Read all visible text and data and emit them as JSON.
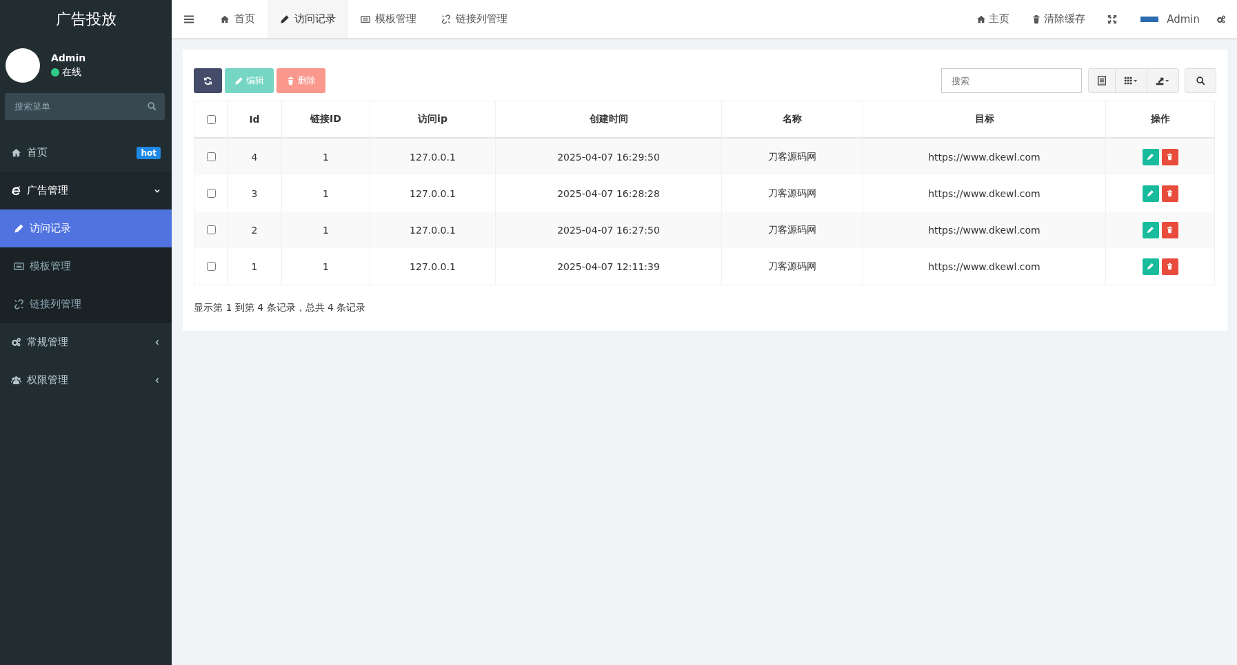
{
  "sidebar": {
    "title": "广告投放",
    "user": {
      "name": "Admin",
      "status": "在线",
      "online": true
    },
    "search": {
      "placeholder": "搜索菜单"
    },
    "items": [
      {
        "kind": "link",
        "label": "首页",
        "badge": "hot",
        "selected": false
      },
      {
        "kind": "group",
        "label": "广告管理",
        "expanded": true,
        "selected": false,
        "children": [
          {
            "label": "访问记录",
            "selected": true
          },
          {
            "label": "模板管理",
            "selected": false
          },
          {
            "label": "链接列管理",
            "selected": false
          }
        ]
      },
      {
        "kind": "group",
        "label": "常规管理",
        "expanded": false,
        "selected": false
      },
      {
        "kind": "group",
        "label": "权限管理",
        "expanded": false,
        "selected": false
      }
    ]
  },
  "tabs": [
    {
      "label": "首页",
      "selected": false
    },
    {
      "label": "访问记录",
      "selected": true
    },
    {
      "label": "模板管理",
      "selected": false
    },
    {
      "label": "链接列管理",
      "selected": false
    }
  ],
  "navbar": {
    "links": [
      "主页",
      "清除缓存"
    ],
    "user": "Admin"
  },
  "toolbar": {
    "buttons": [
      {
        "kind": "refresh",
        "disabled": false
      },
      {
        "kind": "edit",
        "label": "编辑",
        "disabled": true
      },
      {
        "kind": "delete",
        "label": "删除",
        "disabled": true
      }
    ],
    "search": {
      "placeholder": "搜索"
    }
  },
  "table": {
    "all_checked": false,
    "columns": [
      "Id",
      "链接ID",
      "访问ip",
      "创建时间",
      "名称",
      "目标",
      "操作"
    ],
    "rows": [
      {
        "checked": false,
        "cells": [
          "4",
          "1",
          "127.0.0.1",
          "2025-04-07 16:29:50",
          "刀客源码网",
          "https://www.dkewl.com"
        ]
      },
      {
        "checked": false,
        "cells": [
          "3",
          "1",
          "127.0.0.1",
          "2025-04-07 16:28:28",
          "刀客源码网",
          "https://www.dkewl.com"
        ]
      },
      {
        "checked": false,
        "cells": [
          "2",
          "1",
          "127.0.0.1",
          "2025-04-07 16:27:50",
          "刀客源码网",
          "https://www.dkewl.com"
        ]
      },
      {
        "checked": false,
        "cells": [
          "1",
          "1",
          "127.0.0.1",
          "2025-04-07 12:11:39",
          "刀客源码网",
          "https://www.dkewl.com"
        ]
      }
    ]
  },
  "pagination": {
    "summary": "显示第 1 到第 4 条记录，总共 4 条记录"
  }
}
